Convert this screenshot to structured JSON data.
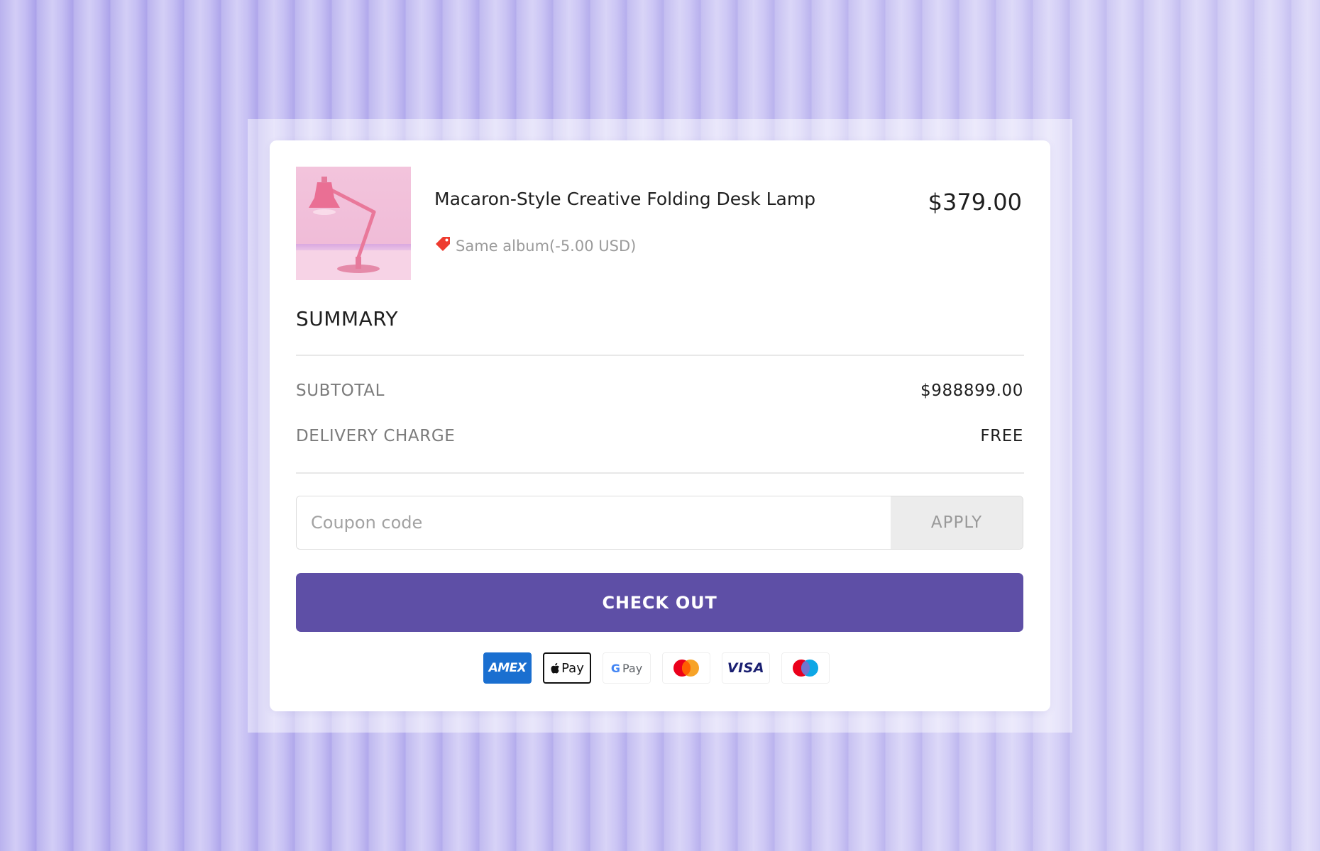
{
  "product": {
    "name": "Macaron-Style Creative Folding Desk Lamp",
    "price": "$379.00",
    "discount_text": "Same album(-5.00 USD)",
    "image_alt": "pink desk lamp"
  },
  "summary": {
    "title": "SUMMARY",
    "subtotal_label": "SUBTOTAL",
    "subtotal_value": "$988899.00",
    "delivery_label": "DELIVERY CHARGE",
    "delivery_value": "FREE"
  },
  "coupon": {
    "placeholder": "Coupon code",
    "value": "",
    "apply_label": "APPLY"
  },
  "checkout": {
    "label": "CHECK OUT"
  },
  "payment_methods": [
    {
      "icon": "amex-icon",
      "label": "AMEX"
    },
    {
      "icon": "apple-pay-icon",
      "label": "Pay"
    },
    {
      "icon": "google-pay-icon",
      "label": "Pay"
    },
    {
      "icon": "mastercard-icon"
    },
    {
      "icon": "visa-icon",
      "label": "VISA"
    },
    {
      "icon": "maestro-icon"
    }
  ],
  "colors": {
    "accent": "#5e4fa6",
    "discount_tag": "#ee3b2f",
    "background": "#c4bdf3"
  }
}
